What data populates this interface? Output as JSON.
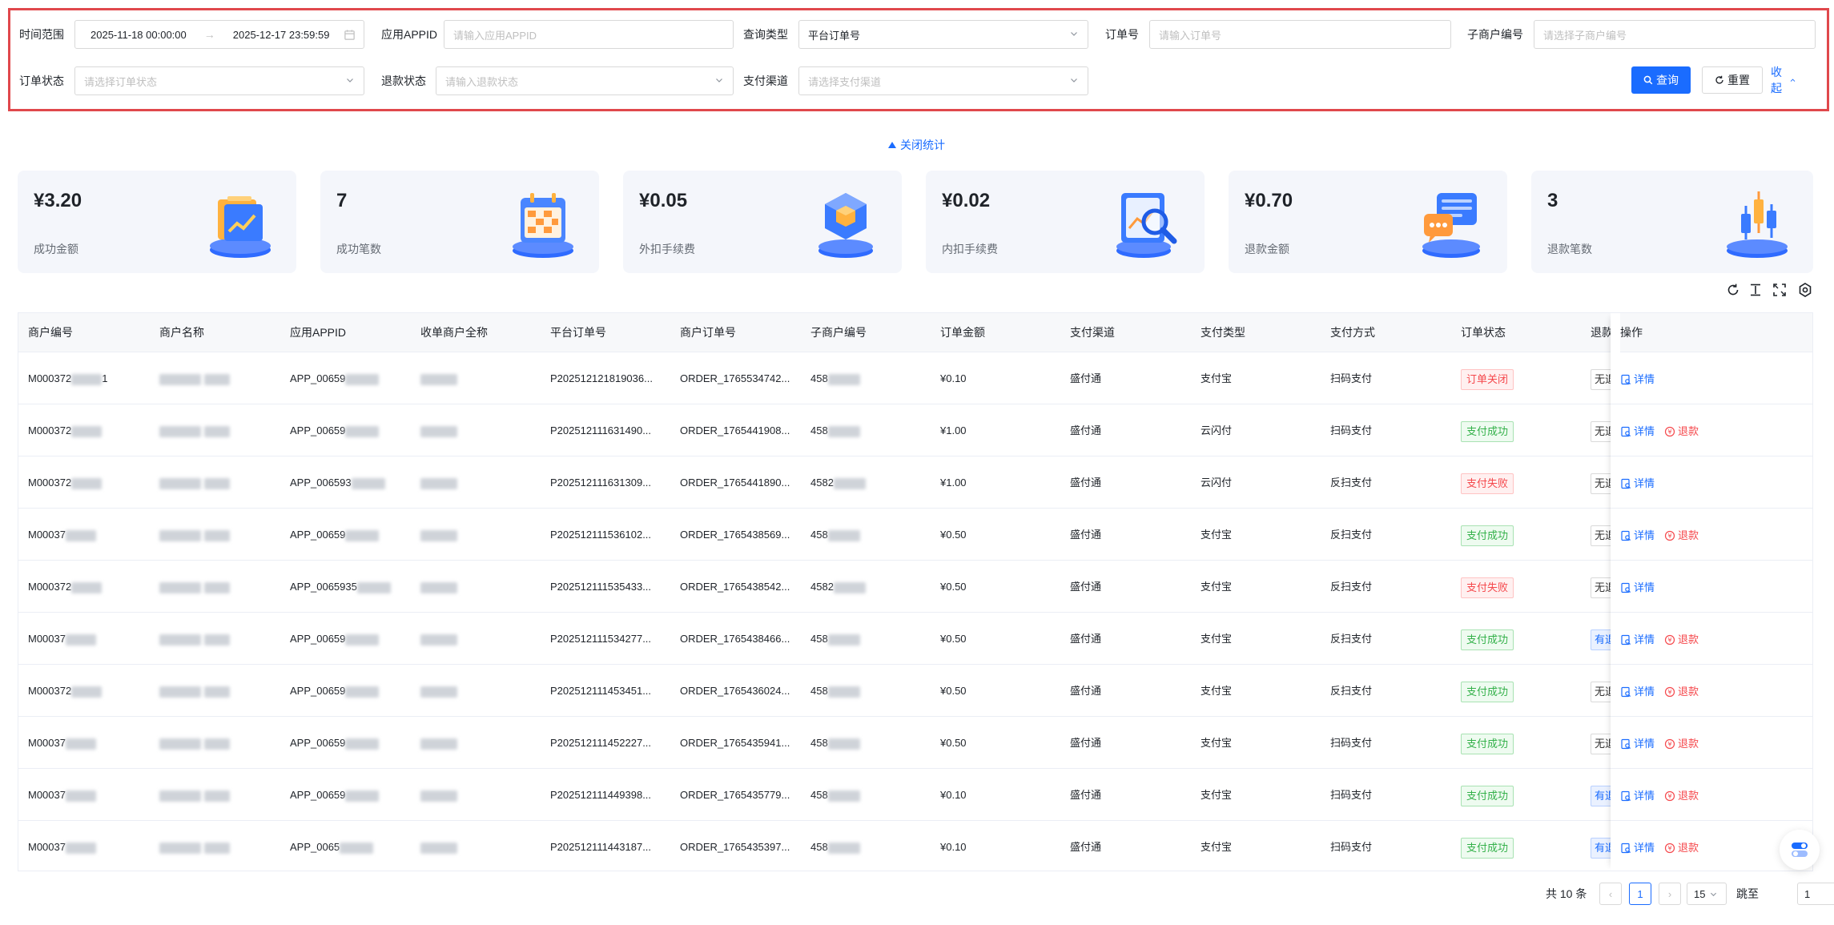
{
  "filters": {
    "time_range_label": "时间范围",
    "time_start": "2025-11-18 00:00:00",
    "time_sep": "→",
    "time_end": "2025-12-17 23:59:59",
    "appid_label": "应用APPID",
    "appid_placeholder": "请输入应用APPID",
    "query_type_label": "查询类型",
    "query_type_value": "平台订单号",
    "order_no_label": "订单号",
    "order_no_placeholder": "请输入订单号",
    "sub_merchant_label": "子商户编号",
    "sub_merchant_placeholder": "请选择子商户编号",
    "order_status_label": "订单状态",
    "order_status_placeholder": "请选择订单状态",
    "refund_status_label": "退款状态",
    "refund_status_placeholder": "请输入退款状态",
    "pay_channel_label": "支付渠道",
    "pay_channel_placeholder": "请选择支付渠道",
    "query_button": "查询",
    "reset_button": "重置",
    "collapse_button": "收起"
  },
  "stats_toggle": "关闭统计",
  "stats": [
    {
      "value": "¥3.20",
      "label": "成功金额",
      "icon": "folder-chart-icon"
    },
    {
      "value": "7",
      "label": "成功笔数",
      "icon": "calendar-icon"
    },
    {
      "value": "¥0.05",
      "label": "外扣手续费",
      "icon": "cube-icon"
    },
    {
      "value": "¥0.02",
      "label": "内扣手续费",
      "icon": "magnifier-report-icon"
    },
    {
      "value": "¥0.70",
      "label": "退款金额",
      "icon": "chat-icon"
    },
    {
      "value": "3",
      "label": "退款笔数",
      "icon": "candlestick-icon"
    }
  ],
  "table": {
    "headers": [
      "商户编号",
      "商户名称",
      "应用APPID",
      "收单商户全称",
      "平台订单号",
      "商户订单号",
      "子商户编号",
      "订单金额",
      "支付渠道",
      "支付类型",
      "支付方式",
      "订单状态",
      "退款",
      "操作"
    ],
    "rows": [
      {
        "merchant_no": "M000372",
        "merchant_no_tail": "1",
        "app_id": "APP_00659",
        "platform_order": "P202512121819036...",
        "merchant_order": "ORDER_1765534742...",
        "sub_merchant": "458",
        "amount": "¥0.10",
        "channel": "盛付通",
        "pay_type": "支付宝",
        "pay_method": "扫码支付",
        "status": "订单关闭",
        "status_kind": "close",
        "refund": "无退",
        "refund_kind": "none",
        "has_refund_op": false
      },
      {
        "merchant_no": "M000372",
        "merchant_no_tail": "",
        "app_id": "APP_00659",
        "platform_order": "P202512111631490...",
        "merchant_order": "ORDER_1765441908...",
        "sub_merchant": "458",
        "amount": "¥1.00",
        "channel": "盛付通",
        "pay_type": "云闪付",
        "pay_method": "扫码支付",
        "status": "支付成功",
        "status_kind": "ok",
        "refund": "无退",
        "refund_kind": "none",
        "has_refund_op": true
      },
      {
        "merchant_no": "M000372",
        "merchant_no_tail": "",
        "app_id": "APP_006593",
        "platform_order": "P202512111631309...",
        "merchant_order": "ORDER_1765441890...",
        "sub_merchant": "4582",
        "amount": "¥1.00",
        "channel": "盛付通",
        "pay_type": "云闪付",
        "pay_method": "反扫支付",
        "status": "支付失败",
        "status_kind": "fail",
        "refund": "无退",
        "refund_kind": "none",
        "has_refund_op": false
      },
      {
        "merchant_no": "M00037",
        "merchant_no_tail": "",
        "app_id": "APP_00659",
        "platform_order": "P202512111536102...",
        "merchant_order": "ORDER_1765438569...",
        "sub_merchant": "458",
        "amount": "¥0.50",
        "channel": "盛付通",
        "pay_type": "支付宝",
        "pay_method": "反扫支付",
        "status": "支付成功",
        "status_kind": "ok",
        "refund": "无退",
        "refund_kind": "none",
        "has_refund_op": true
      },
      {
        "merchant_no": "M000372",
        "merchant_no_tail": "",
        "app_id": "APP_0065935",
        "platform_order": "P202512111535433...",
        "merchant_order": "ORDER_1765438542...",
        "sub_merchant": "4582",
        "amount": "¥0.50",
        "channel": "盛付通",
        "pay_type": "支付宝",
        "pay_method": "反扫支付",
        "status": "支付失败",
        "status_kind": "fail",
        "refund": "无退",
        "refund_kind": "none",
        "has_refund_op": false
      },
      {
        "merchant_no": "M00037",
        "merchant_no_tail": "",
        "app_id": "APP_00659",
        "platform_order": "P202512111534277...",
        "merchant_order": "ORDER_1765438466...",
        "sub_merchant": "458",
        "amount": "¥0.50",
        "channel": "盛付通",
        "pay_type": "支付宝",
        "pay_method": "反扫支付",
        "status": "支付成功",
        "status_kind": "ok",
        "refund": "有退",
        "refund_kind": "has",
        "has_refund_op": true
      },
      {
        "merchant_no": "M000372",
        "merchant_no_tail": "",
        "app_id": "APP_00659",
        "platform_order": "P202512111453451...",
        "merchant_order": "ORDER_1765436024...",
        "sub_merchant": "458",
        "amount": "¥0.50",
        "channel": "盛付通",
        "pay_type": "支付宝",
        "pay_method": "反扫支付",
        "status": "支付成功",
        "status_kind": "ok",
        "refund": "无退",
        "refund_kind": "none",
        "has_refund_op": true
      },
      {
        "merchant_no": "M00037",
        "merchant_no_tail": "",
        "app_id": "APP_00659",
        "platform_order": "P202512111452227...",
        "merchant_order": "ORDER_1765435941...",
        "sub_merchant": "458",
        "amount": "¥0.50",
        "channel": "盛付通",
        "pay_type": "支付宝",
        "pay_method": "扫码支付",
        "status": "支付成功",
        "status_kind": "ok",
        "refund": "无退",
        "refund_kind": "none",
        "has_refund_op": true
      },
      {
        "merchant_no": "M00037",
        "merchant_no_tail": "",
        "app_id": "APP_00659",
        "platform_order": "P202512111449398...",
        "merchant_order": "ORDER_1765435779...",
        "sub_merchant": "458",
        "amount": "¥0.10",
        "channel": "盛付通",
        "pay_type": "支付宝",
        "pay_method": "扫码支付",
        "status": "支付成功",
        "status_kind": "ok",
        "refund": "有退",
        "refund_kind": "has",
        "has_refund_op": true
      },
      {
        "merchant_no": "M00037",
        "merchant_no_tail": "",
        "app_id": "APP_0065",
        "platform_order": "P202512111443187...",
        "merchant_order": "ORDER_1765435397...",
        "sub_merchant": "458",
        "amount": "¥0.10",
        "channel": "盛付通",
        "pay_type": "支付宝",
        "pay_method": "扫码支付",
        "status": "支付成功",
        "status_kind": "ok",
        "refund": "有退",
        "refund_kind": "has",
        "has_refund_op": true
      }
    ],
    "op_detail": "详情",
    "op_refund": "退款"
  },
  "pagination": {
    "total": "共 10 条",
    "current_page": "1",
    "page_size": "15",
    "jump_label": "跳至",
    "jump_value": "1"
  },
  "colors": {
    "primary": "#1a6cff",
    "danger": "#f5484c",
    "success": "#34b14a",
    "highlight_border": "#e0484c"
  }
}
